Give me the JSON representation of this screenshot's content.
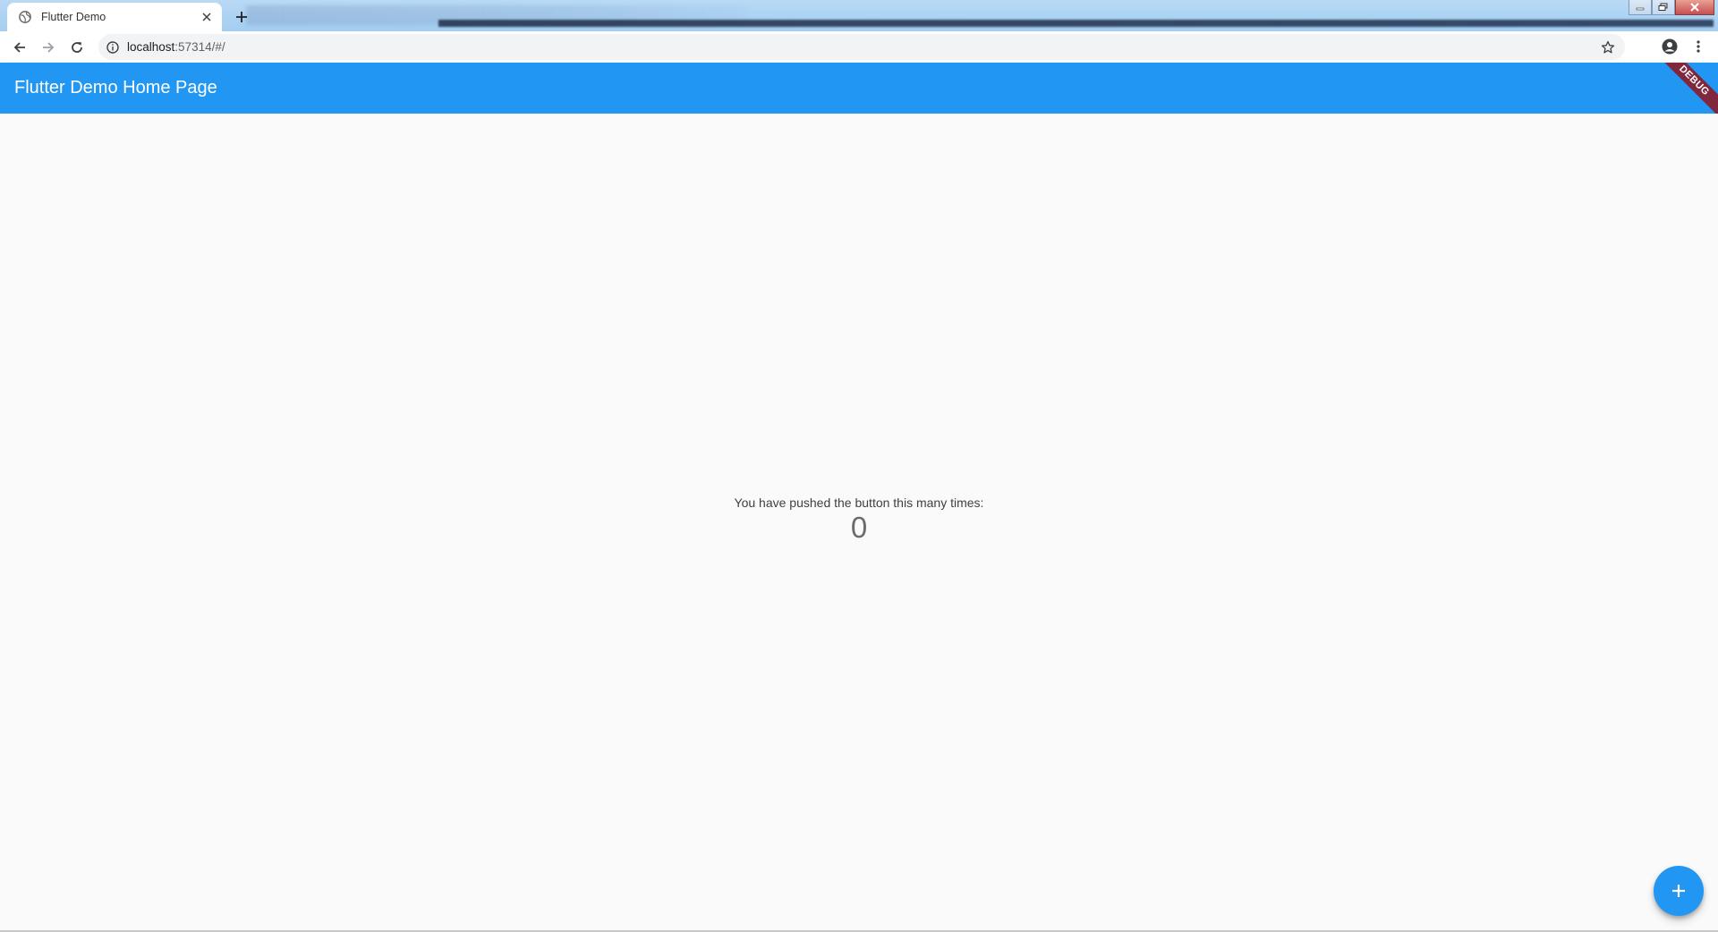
{
  "browser": {
    "tab": {
      "title": "Flutter Demo",
      "favicon": "globe-icon",
      "close_icon": "close-icon"
    },
    "new_tab_icon": "plus-icon",
    "window_controls": [
      "minimize-icon",
      "restore-icon",
      "close-icon"
    ],
    "toolbar": {
      "back_icon": "arrow-left-icon",
      "forward_icon": "arrow-right-icon",
      "reload_icon": "reload-icon",
      "info_icon": "info-icon",
      "url_host": "localhost",
      "url_rest": ":57314/#/",
      "star_icon": "star-icon",
      "profile_icon": "account-circle-icon",
      "menu_icon": "more-vert-icon"
    }
  },
  "app": {
    "appbar": {
      "title": "Flutter Demo Home Page",
      "color": "#2196f3",
      "debug_banner": "DEBUG"
    },
    "body": {
      "label": "You have pushed the button this many times:",
      "counter": "0"
    },
    "fab": {
      "icon": "add-icon",
      "color": "#2196f3"
    }
  }
}
